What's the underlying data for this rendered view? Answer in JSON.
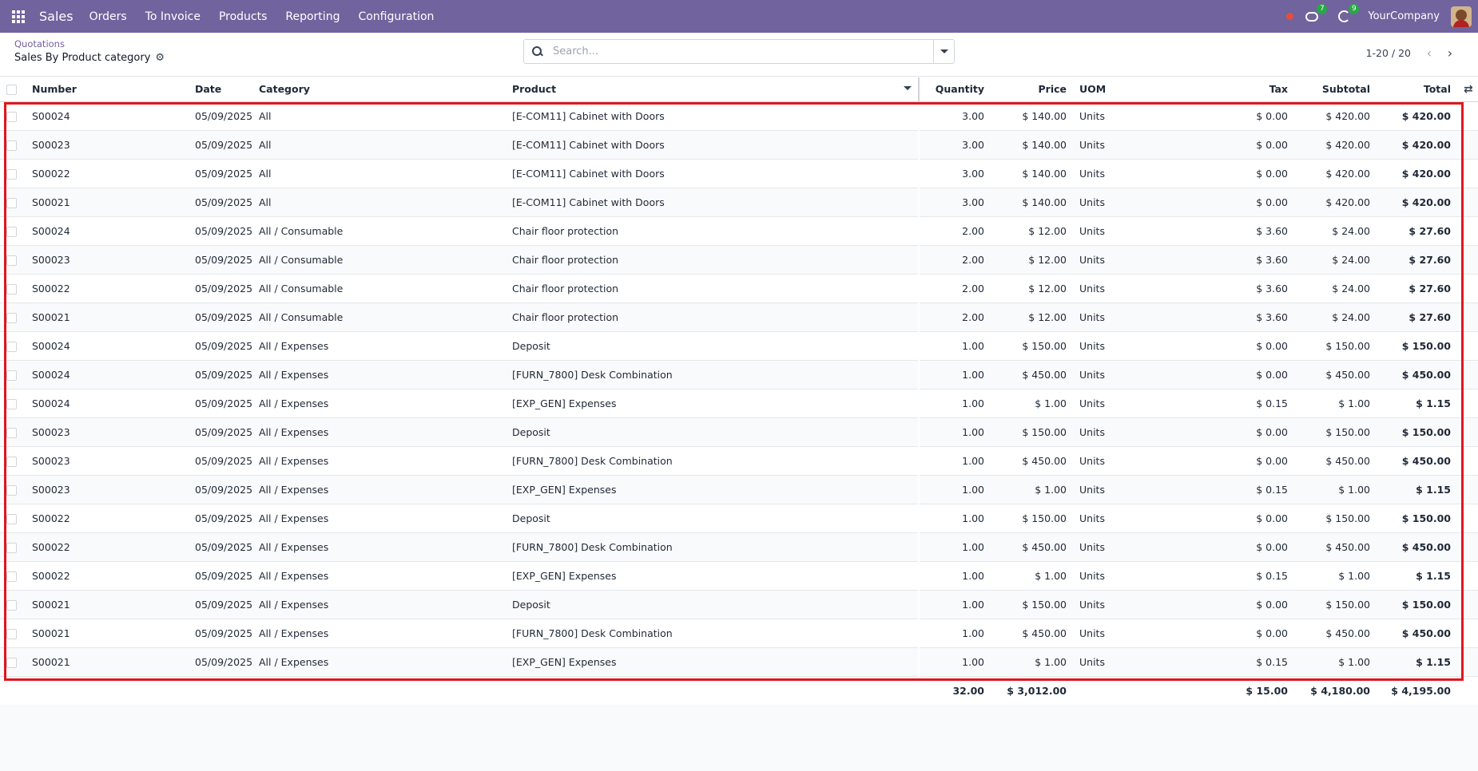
{
  "navbar": {
    "app_name": "Sales",
    "menu": [
      "Orders",
      "To Invoice",
      "Products",
      "Reporting",
      "Configuration"
    ],
    "messages_count": "7",
    "activities_count": "9",
    "company": "YourCompany"
  },
  "control": {
    "breadcrumb": "Quotations",
    "view_title": "Sales By Product category",
    "search_placeholder": "Search...",
    "pager": "1-20 / 20"
  },
  "table": {
    "columns": {
      "number": "Number",
      "date": "Date",
      "category": "Category",
      "product": "Product",
      "quantity": "Quantity",
      "price": "Price",
      "uom": "UOM",
      "tax": "Tax",
      "subtotal": "Subtotal",
      "total": "Total"
    },
    "rows": [
      {
        "number": "S00024",
        "date": "05/09/2025",
        "category": "All",
        "product": "[E-COM11] Cabinet with Doors",
        "quantity": "3.00",
        "price": "$ 140.00",
        "uom": "Units",
        "tax": "$ 0.00",
        "subtotal": "$ 420.00",
        "total": "$ 420.00"
      },
      {
        "number": "S00023",
        "date": "05/09/2025",
        "category": "All",
        "product": "[E-COM11] Cabinet with Doors",
        "quantity": "3.00",
        "price": "$ 140.00",
        "uom": "Units",
        "tax": "$ 0.00",
        "subtotal": "$ 420.00",
        "total": "$ 420.00"
      },
      {
        "number": "S00022",
        "date": "05/09/2025",
        "category": "All",
        "product": "[E-COM11] Cabinet with Doors",
        "quantity": "3.00",
        "price": "$ 140.00",
        "uom": "Units",
        "tax": "$ 0.00",
        "subtotal": "$ 420.00",
        "total": "$ 420.00"
      },
      {
        "number": "S00021",
        "date": "05/09/2025",
        "category": "All",
        "product": "[E-COM11] Cabinet with Doors",
        "quantity": "3.00",
        "price": "$ 140.00",
        "uom": "Units",
        "tax": "$ 0.00",
        "subtotal": "$ 420.00",
        "total": "$ 420.00"
      },
      {
        "number": "S00024",
        "date": "05/09/2025",
        "category": "All / Consumable",
        "product": "Chair floor protection",
        "quantity": "2.00",
        "price": "$ 12.00",
        "uom": "Units",
        "tax": "$ 3.60",
        "subtotal": "$ 24.00",
        "total": "$ 27.60"
      },
      {
        "number": "S00023",
        "date": "05/09/2025",
        "category": "All / Consumable",
        "product": "Chair floor protection",
        "quantity": "2.00",
        "price": "$ 12.00",
        "uom": "Units",
        "tax": "$ 3.60",
        "subtotal": "$ 24.00",
        "total": "$ 27.60"
      },
      {
        "number": "S00022",
        "date": "05/09/2025",
        "category": "All / Consumable",
        "product": "Chair floor protection",
        "quantity": "2.00",
        "price": "$ 12.00",
        "uom": "Units",
        "tax": "$ 3.60",
        "subtotal": "$ 24.00",
        "total": "$ 27.60"
      },
      {
        "number": "S00021",
        "date": "05/09/2025",
        "category": "All / Consumable",
        "product": "Chair floor protection",
        "quantity": "2.00",
        "price": "$ 12.00",
        "uom": "Units",
        "tax": "$ 3.60",
        "subtotal": "$ 24.00",
        "total": "$ 27.60"
      },
      {
        "number": "S00024",
        "date": "05/09/2025",
        "category": "All / Expenses",
        "product": "Deposit",
        "quantity": "1.00",
        "price": "$ 150.00",
        "uom": "Units",
        "tax": "$ 0.00",
        "subtotal": "$ 150.00",
        "total": "$ 150.00"
      },
      {
        "number": "S00024",
        "date": "05/09/2025",
        "category": "All / Expenses",
        "product": "[FURN_7800] Desk Combination",
        "quantity": "1.00",
        "price": "$ 450.00",
        "uom": "Units",
        "tax": "$ 0.00",
        "subtotal": "$ 450.00",
        "total": "$ 450.00"
      },
      {
        "number": "S00024",
        "date": "05/09/2025",
        "category": "All / Expenses",
        "product": "[EXP_GEN] Expenses",
        "quantity": "1.00",
        "price": "$ 1.00",
        "uom": "Units",
        "tax": "$ 0.15",
        "subtotal": "$ 1.00",
        "total": "$ 1.15"
      },
      {
        "number": "S00023",
        "date": "05/09/2025",
        "category": "All / Expenses",
        "product": "Deposit",
        "quantity": "1.00",
        "price": "$ 150.00",
        "uom": "Units",
        "tax": "$ 0.00",
        "subtotal": "$ 150.00",
        "total": "$ 150.00"
      },
      {
        "number": "S00023",
        "date": "05/09/2025",
        "category": "All / Expenses",
        "product": "[FURN_7800] Desk Combination",
        "quantity": "1.00",
        "price": "$ 450.00",
        "uom": "Units",
        "tax": "$ 0.00",
        "subtotal": "$ 450.00",
        "total": "$ 450.00"
      },
      {
        "number": "S00023",
        "date": "05/09/2025",
        "category": "All / Expenses",
        "product": "[EXP_GEN] Expenses",
        "quantity": "1.00",
        "price": "$ 1.00",
        "uom": "Units",
        "tax": "$ 0.15",
        "subtotal": "$ 1.00",
        "total": "$ 1.15"
      },
      {
        "number": "S00022",
        "date": "05/09/2025",
        "category": "All / Expenses",
        "product": "Deposit",
        "quantity": "1.00",
        "price": "$ 150.00",
        "uom": "Units",
        "tax": "$ 0.00",
        "subtotal": "$ 150.00",
        "total": "$ 150.00"
      },
      {
        "number": "S00022",
        "date": "05/09/2025",
        "category": "All / Expenses",
        "product": "[FURN_7800] Desk Combination",
        "quantity": "1.00",
        "price": "$ 450.00",
        "uom": "Units",
        "tax": "$ 0.00",
        "subtotal": "$ 450.00",
        "total": "$ 450.00"
      },
      {
        "number": "S00022",
        "date": "05/09/2025",
        "category": "All / Expenses",
        "product": "[EXP_GEN] Expenses",
        "quantity": "1.00",
        "price": "$ 1.00",
        "uom": "Units",
        "tax": "$ 0.15",
        "subtotal": "$ 1.00",
        "total": "$ 1.15"
      },
      {
        "number": "S00021",
        "date": "05/09/2025",
        "category": "All / Expenses",
        "product": "Deposit",
        "quantity": "1.00",
        "price": "$ 150.00",
        "uom": "Units",
        "tax": "$ 0.00",
        "subtotal": "$ 150.00",
        "total": "$ 150.00"
      },
      {
        "number": "S00021",
        "date": "05/09/2025",
        "category": "All / Expenses",
        "product": "[FURN_7800] Desk Combination",
        "quantity": "1.00",
        "price": "$ 450.00",
        "uom": "Units",
        "tax": "$ 0.00",
        "subtotal": "$ 450.00",
        "total": "$ 450.00"
      },
      {
        "number": "S00021",
        "date": "05/09/2025",
        "category": "All / Expenses",
        "product": "[EXP_GEN] Expenses",
        "quantity": "1.00",
        "price": "$ 1.00",
        "uom": "Units",
        "tax": "$ 0.15",
        "subtotal": "$ 1.00",
        "total": "$ 1.15"
      }
    ],
    "totals": {
      "quantity": "32.00",
      "price": "$ 3,012.00",
      "tax": "$ 15.00",
      "subtotal": "$ 4,180.00",
      "total": "$ 4,195.00"
    }
  },
  "colors": {
    "navbar": "#71639e",
    "highlight": "#e0161f",
    "badge": "#28a745"
  }
}
